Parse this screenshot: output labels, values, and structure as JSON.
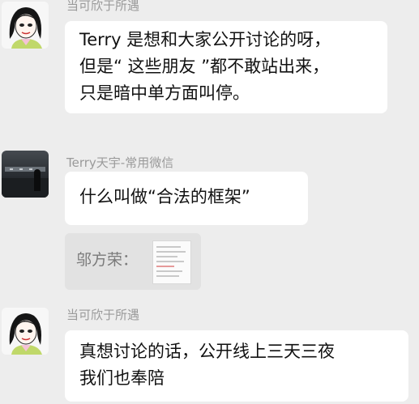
{
  "messages": [
    {
      "sender": "当可欣于所遇",
      "lines": [
        "Terry 是想和大家公开讨论的呀，",
        "但是“ 这些朋友 ”都不敢站出来，",
        "只是暗中单方面叫停。"
      ]
    },
    {
      "sender": "Terry天宇-常用微信",
      "lines": [
        "什么叫做“合法的框架”"
      ],
      "quote": {
        "text": "邬方荣："
      }
    },
    {
      "sender": "当可欣于所遇",
      "lines": [
        "真想讨论的话，公开线上三天三夜",
        "我们也奉陪"
      ]
    }
  ],
  "colors": {
    "background": "#ededed",
    "bubble": "#ffffff",
    "quote_bubble": "#e2e2e2",
    "sender_text": "#9a9a9a"
  },
  "icons": [
    "woman-cartoon-avatar-icon",
    "dark-photo-avatar-icon",
    "document-thumbnail-icon"
  ]
}
